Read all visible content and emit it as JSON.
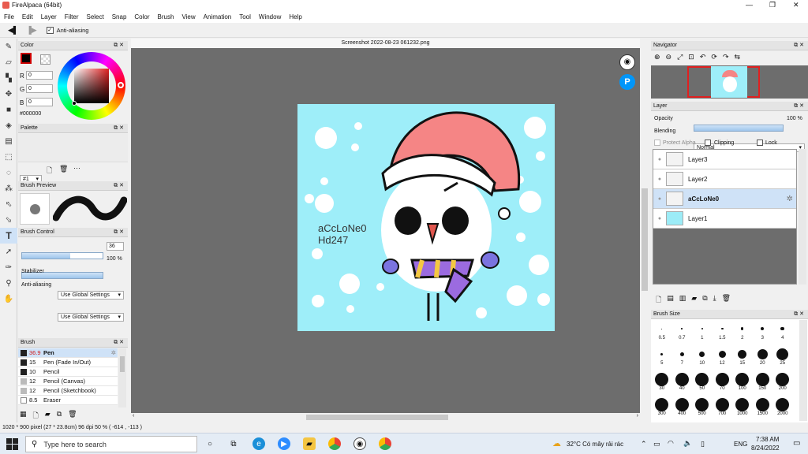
{
  "window": {
    "title": "FireAlpaca (64bit)",
    "controls": [
      "—",
      "❐",
      "✕"
    ]
  },
  "menu": [
    "File",
    "Edit",
    "Layer",
    "Filter",
    "Select",
    "Snap",
    "Color",
    "Brush",
    "View",
    "Animation",
    "Tool",
    "Window",
    "Help"
  ],
  "toolbar": {
    "antialias_label": "Anti-aliasing",
    "antialias_checked": true
  },
  "color_panel": {
    "title": "Color",
    "r_label": "R",
    "g_label": "G",
    "b_label": "B",
    "r": "0",
    "g": "0",
    "b": "0",
    "hex": "#000000",
    "fg_color": "#000000"
  },
  "palette_panel": {
    "title": "Palette",
    "selected": "#1"
  },
  "brush_preview": {
    "title": "Brush Preview"
  },
  "brush_control": {
    "title": "Brush Control",
    "size_value": "36",
    "size_fraction": 0.6,
    "opacity_label": "100 %",
    "opacity_fraction": 1.0,
    "stabilizer_label": "Stabilizer",
    "stabilizer_value": "Use Global Settings",
    "antialiasing_label": "Anti-aliasing",
    "antialiasing_value": "Use Global Settings"
  },
  "brush_panel": {
    "title": "Brush",
    "items": [
      {
        "size": "36.9",
        "name": "Pen",
        "selected": true
      },
      {
        "size": "15",
        "name": "Pen (Fade In/Out)"
      },
      {
        "size": "10",
        "name": "Pencil"
      },
      {
        "size": "12",
        "name": "Pencil (Canvas)"
      },
      {
        "size": "12",
        "name": "Pencil (Sketchbook)"
      },
      {
        "size": "8.5",
        "name": "Eraser"
      }
    ]
  },
  "document": {
    "tab_title": "Screenshot 2022-08-23 061232.png"
  },
  "artwork": {
    "text_line1": "aCcLoNe0",
    "text_line2": "Hd247",
    "bg_color": "#9eeef9"
  },
  "navigator": {
    "title": "Navigator"
  },
  "layer_panel": {
    "title": "Layer",
    "opacity_label": "Opacity",
    "opacity_value": "100 %",
    "blending_label": "Blending",
    "blending_value": "Normal",
    "protect_alpha": "Protect Alpha",
    "clipping": "Clipping",
    "lock": "Lock",
    "layers": [
      {
        "name": "Layer3",
        "selected": false
      },
      {
        "name": "Layer2",
        "selected": false
      },
      {
        "name": "aCcLoNe0",
        "selected": true
      },
      {
        "name": "Layer1",
        "selected": false
      }
    ]
  },
  "brush_size_panel": {
    "title": "Brush Size",
    "sizes": [
      "0.5",
      "0.7",
      "1",
      "1.5",
      "2",
      "3",
      "4",
      "5",
      "7",
      "10",
      "12",
      "15",
      "20",
      "25",
      "30",
      "40",
      "50",
      "70",
      "100",
      "150",
      "200",
      "300",
      "400",
      "500",
      "700",
      "1000",
      "1500",
      "2000"
    ]
  },
  "status": {
    "text": "1020 * 900 pixel   (27 * 23.8cm)   96 dpi   50 %   ( -614 , -113 )"
  },
  "taskbar": {
    "search_placeholder": "Type here to search",
    "weather": "32°C  Có mây rải rác",
    "lang": "ENG",
    "time": "7:38 AM",
    "date": "8/24/2022"
  }
}
